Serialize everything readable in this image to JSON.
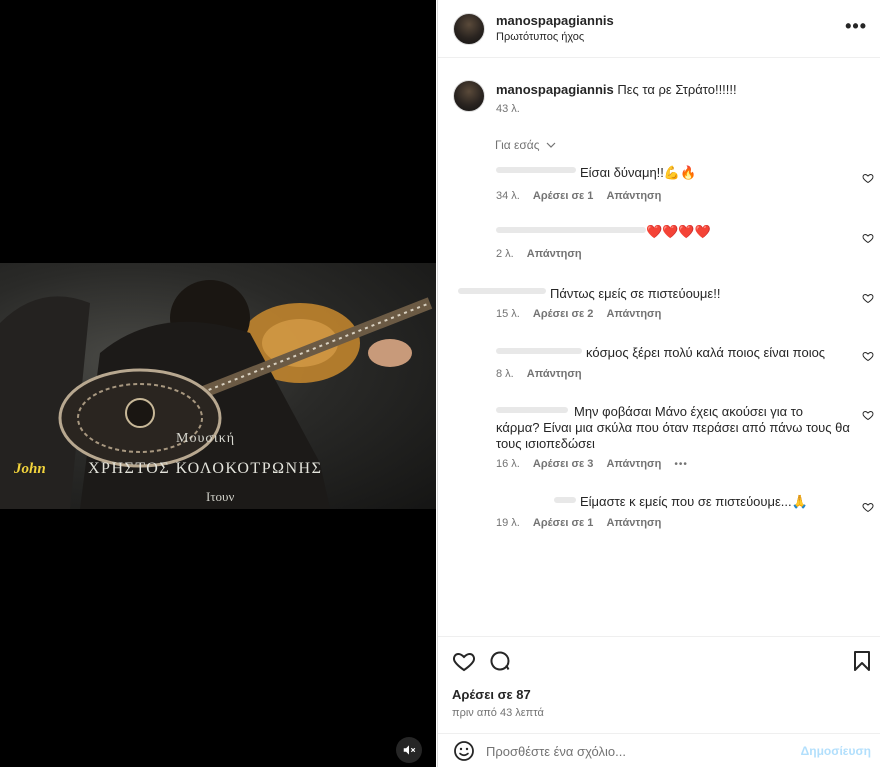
{
  "media": {
    "overlay_left": "John",
    "overlay_top": "Μουσική",
    "overlay_main": "ΧΡΗΣΤΟΣ ΚΟΛΟΚΟΤΡΩΝΗΣ",
    "overlay_bottom": "Ιτουν"
  },
  "post": {
    "username": "manospapagiannis",
    "audio": "Πρωτότυπος ήχος",
    "caption_user": "manospapagiannis",
    "caption_text": "Πες τα ρε Στράτο!!!!!!",
    "caption_time": "43 λ."
  },
  "filter_label": "Για εσάς",
  "comments": [
    {
      "text": "Είσαι δύναμη!!💪🔥",
      "time": "34 λ.",
      "likes": "Αρέσει σε 1",
      "reply": "Απάντηση"
    },
    {
      "text": "❤️❤️❤️❤️",
      "time": "2 λ.",
      "likes": "",
      "reply": "Απάντηση"
    },
    {
      "text": "Πάντως εμείς σε πιστεύουμε!!",
      "time": "15 λ.",
      "likes": "Αρέσει σε 2",
      "reply": "Απάντηση"
    },
    {
      "text": "κόσμος ξέρει πολύ καλά ποιος είναι ποιος",
      "time": "8 λ.",
      "likes": "",
      "reply": "Απάντηση"
    },
    {
      "text_line1": "Μην φοβάσαι Μάνο έχεις ακούσει για το",
      "text_line2": "κάρμα? Είναι μια σκύλα που όταν περάσει από πάνω τους θα",
      "text_line3": "τους ισιοπεδώσει",
      "time": "16 λ.",
      "likes": "Αρέσει σε 3",
      "reply": "Απάντηση",
      "more": "•••"
    },
    {
      "text": "Είμαστε κ εμείς που σε πιστεύουμε...🙏",
      "time": "19 λ.",
      "likes": "Αρέσει σε 1",
      "reply": "Απάντηση"
    }
  ],
  "footer": {
    "likes": "Αρέσει σε 87",
    "time": "πριν από 43 λεπτά",
    "comment_placeholder": "Προσθέστε ένα σχόλιο...",
    "publish": "Δημοσίευση"
  },
  "colors": {
    "heart_red": "#ed4956",
    "publish_disabled": "#b2dffc",
    "overlay_yellow": "#f2d43c"
  }
}
